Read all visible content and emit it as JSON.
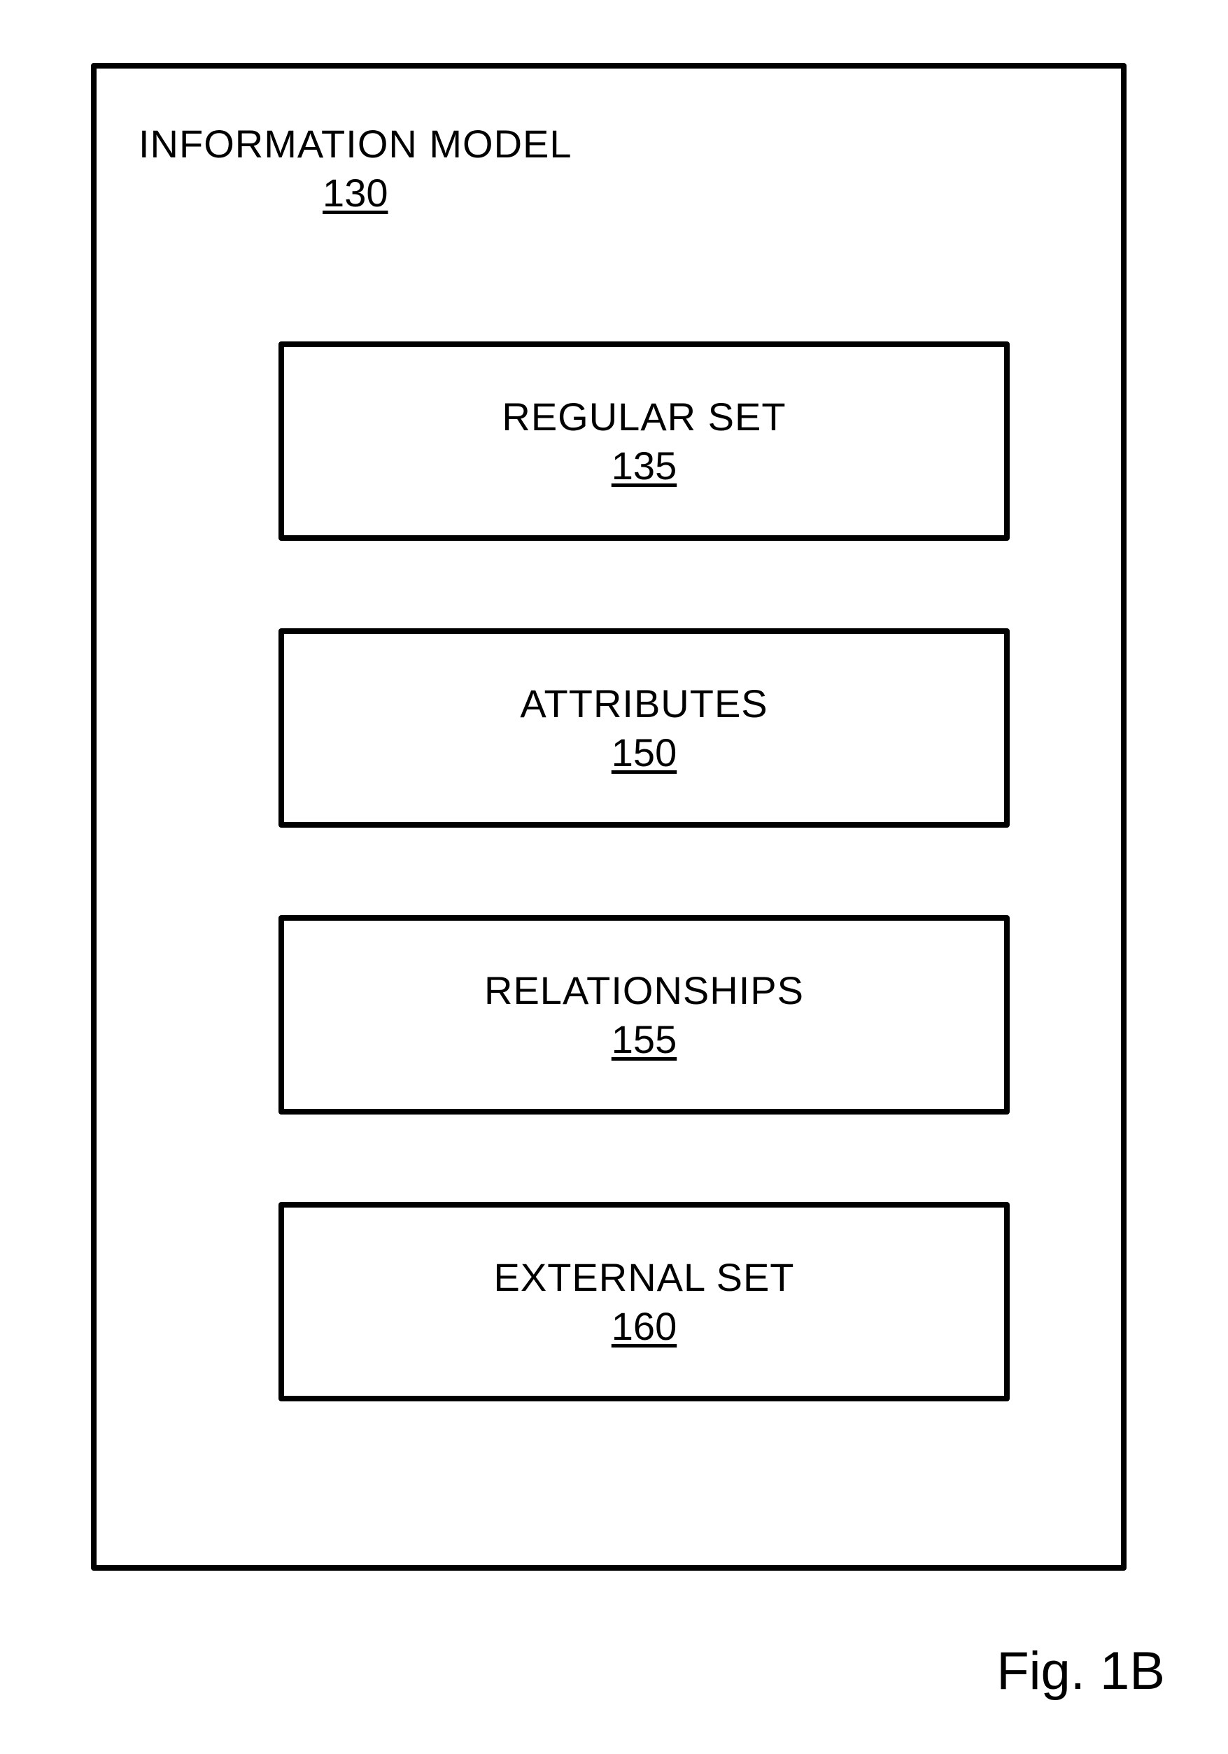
{
  "diagram": {
    "title": "INFORMATION MODEL",
    "title_ref": "130",
    "boxes": [
      {
        "label": "REGULAR SET",
        "ref": "135"
      },
      {
        "label": "ATTRIBUTES",
        "ref": "150"
      },
      {
        "label": "RELATIONSHIPS",
        "ref": "155"
      },
      {
        "label": "EXTERNAL SET",
        "ref": "160"
      }
    ]
  },
  "caption": "Fig. 1B"
}
